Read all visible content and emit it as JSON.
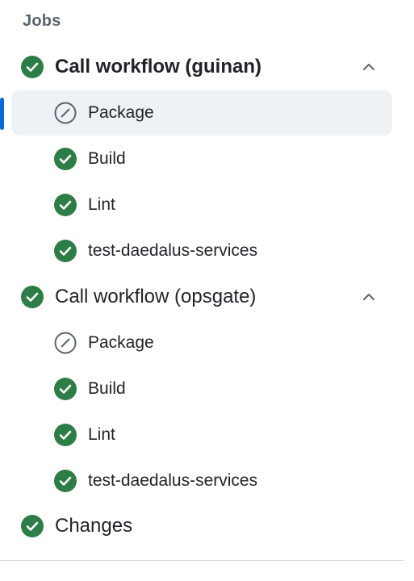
{
  "sidebar": {
    "title": "Jobs",
    "groups": [
      {
        "label": "Call workflow (guinan)",
        "status": "success",
        "expanded": true,
        "chevron": "chevron-up-icon",
        "jobs": [
          {
            "label": "Package",
            "status": "skipped",
            "selected": true
          },
          {
            "label": "Build",
            "status": "success"
          },
          {
            "label": "Lint",
            "status": "success"
          },
          {
            "label": "test-daedalus-services",
            "status": "success"
          }
        ]
      },
      {
        "label": "Call workflow (opsgate)",
        "status": "success",
        "expanded": true,
        "chevron": "chevron-up-icon",
        "jobs": [
          {
            "label": "Package",
            "status": "skipped"
          },
          {
            "label": "Build",
            "status": "success"
          },
          {
            "label": "Lint",
            "status": "success"
          },
          {
            "label": "test-daedalus-services",
            "status": "success"
          }
        ]
      }
    ],
    "changes": {
      "label": "Changes",
      "status": "success"
    }
  },
  "colors": {
    "success": "#2da44e",
    "skipped": "#59636e",
    "selected_bg": "#eff2f5",
    "active_marker": "#0969da"
  }
}
